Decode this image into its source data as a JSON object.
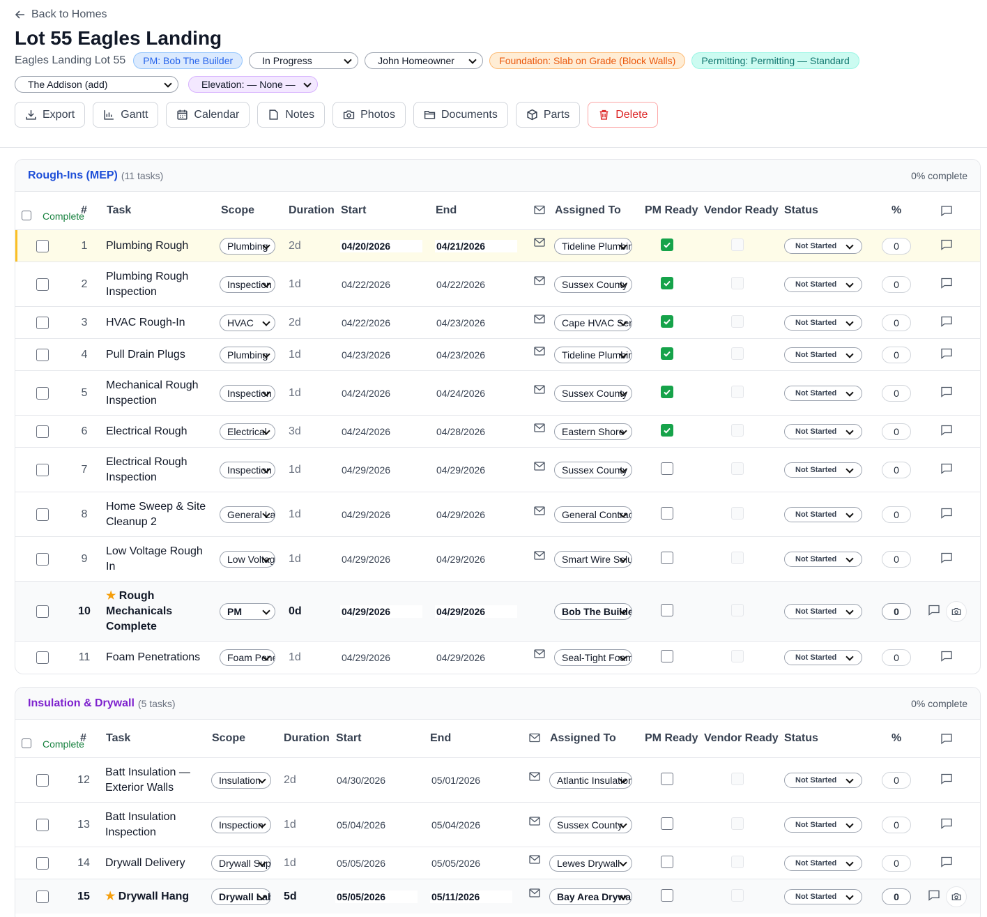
{
  "header": {
    "back_label": "Back to Homes",
    "title": "Lot 55 Eagles Landing",
    "subtitle": "Eagles Landing Lot 55",
    "pm_badge": "PM: Bob The Builder",
    "status_select": "In Progress",
    "homeowner_select": "John Homeowner",
    "foundation_badge": "Foundation: Slab on Grade (Block Walls)",
    "permitting_badge": "Permitting: Permitting — Standard",
    "plan_select": "The Addison (add)",
    "elevation_select": "Elevation: — None —"
  },
  "toolbar": {
    "export": "Export",
    "gantt": "Gantt",
    "calendar": "Calendar",
    "notes": "Notes",
    "photos": "Photos",
    "documents": "Documents",
    "parts": "Parts",
    "delete": "Delete"
  },
  "colors": {
    "section1": "#1d4ed8",
    "section2": "#7e22ce"
  },
  "columns": {
    "complete": "Complete",
    "num": "#",
    "task": "Task",
    "scope": "Scope",
    "duration": "Duration",
    "start": "Start",
    "end": "End",
    "assigned": "Assigned To",
    "pm_ready": "PM Ready",
    "vendor_ready": "Vendor Ready",
    "status": "Status",
    "pct": "%"
  },
  "sections": [
    {
      "name": "Rough-Ins (MEP)",
      "count": "(11 tasks)",
      "complete": "0% complete",
      "rows": [
        {
          "num": "1",
          "task": "Plumbing Rough",
          "scope": "Plumbing",
          "dur": "2d",
          "start": "04/20/2026",
          "end": "04/21/2026",
          "assigned": "Tideline Plumbing",
          "pm": true,
          "status": "Not Started",
          "pct": "0",
          "env": true,
          "type": "hl"
        },
        {
          "num": "2",
          "task": "Plumbing Rough Inspection",
          "scope": "Inspection",
          "dur": "1d",
          "start": "04/22/2026",
          "end": "04/22/2026",
          "assigned": "Sussex County",
          "pm": true,
          "status": "Not Started",
          "pct": "0",
          "env": true
        },
        {
          "num": "3",
          "task": "HVAC Rough-In",
          "scope": "HVAC",
          "dur": "2d",
          "start": "04/22/2026",
          "end": "04/23/2026",
          "assigned": "Cape HVAC Service",
          "pm": true,
          "status": "Not Started",
          "pct": "0",
          "env": true
        },
        {
          "num": "4",
          "task": "Pull Drain Plugs",
          "scope": "Plumbing",
          "dur": "1d",
          "start": "04/23/2026",
          "end": "04/23/2026",
          "assigned": "Tideline Plumbing",
          "pm": true,
          "status": "Not Started",
          "pct": "0",
          "env": true
        },
        {
          "num": "5",
          "task": "Mechanical Rough Inspection",
          "scope": "Inspection",
          "dur": "1d",
          "start": "04/24/2026",
          "end": "04/24/2026",
          "assigned": "Sussex County",
          "pm": true,
          "status": "Not Started",
          "pct": "0",
          "env": true
        },
        {
          "num": "6",
          "task": "Electrical Rough",
          "scope": "Electrical",
          "dur": "3d",
          "start": "04/24/2026",
          "end": "04/28/2026",
          "assigned": "Eastern Shore",
          "pm": true,
          "status": "Not Started",
          "pct": "0",
          "env": true
        },
        {
          "num": "7",
          "task": "Electrical Rough Inspection",
          "scope": "Inspection",
          "dur": "1d",
          "start": "04/29/2026",
          "end": "04/29/2026",
          "assigned": "Sussex County",
          "pm": false,
          "status": "Not Started",
          "pct": "0",
          "env": true
        },
        {
          "num": "8",
          "task": "Home Sweep & Site Cleanup 2",
          "scope": "General Labor",
          "dur": "1d",
          "start": "04/29/2026",
          "end": "04/29/2026",
          "assigned": "General Contractor",
          "pm": false,
          "status": "Not Started",
          "pct": "0",
          "env": true
        },
        {
          "num": "9",
          "task": "Low Voltage Rough In",
          "scope": "Low Voltage",
          "dur": "1d",
          "start": "04/29/2026",
          "end": "04/29/2026",
          "assigned": "Smart Wire Solutions",
          "pm": false,
          "status": "Not Started",
          "pct": "0",
          "env": true
        },
        {
          "num": "10",
          "task": "Rough Mechanicals Complete",
          "scope": "PM",
          "dur": "0d",
          "start": "04/29/2026",
          "end": "04/29/2026",
          "assigned": "Bob The Builder",
          "pm": false,
          "status": "Not Started",
          "pct": "0",
          "env": false,
          "type": "ms",
          "star": "★"
        },
        {
          "num": "11",
          "task": "Foam Penetrations",
          "scope": "Foam Penetrations",
          "dur": "1d",
          "start": "04/29/2026",
          "end": "04/29/2026",
          "assigned": "Seal-Tight Foam",
          "pm": false,
          "status": "Not Started",
          "pct": "0",
          "env": true
        }
      ]
    },
    {
      "name": "Insulation & Drywall",
      "count": "(5 tasks)",
      "complete": "0% complete",
      "rows": [
        {
          "num": "12",
          "task": "Batt Insulation — Exterior Walls",
          "scope": "Insulation",
          "dur": "2d",
          "start": "04/30/2026",
          "end": "05/01/2026",
          "assigned": "Atlantic Insulation",
          "pm": false,
          "status": "Not Started",
          "pct": "0",
          "env": true
        },
        {
          "num": "13",
          "task": "Batt Insulation Inspection",
          "scope": "Inspection",
          "dur": "1d",
          "start": "05/04/2026",
          "end": "05/04/2026",
          "assigned": "Sussex County",
          "pm": false,
          "status": "Not Started",
          "pct": "0",
          "env": true
        },
        {
          "num": "14",
          "task": "Drywall Delivery",
          "scope": "Drywall Supply",
          "dur": "1d",
          "start": "05/05/2026",
          "end": "05/05/2026",
          "assigned": "Lewes Drywall",
          "pm": false,
          "status": "Not Started",
          "pct": "0",
          "env": true
        },
        {
          "num": "15",
          "task": "Drywall Hang",
          "scope": "Drywall Labor",
          "dur": "5d",
          "start": "05/05/2026",
          "end": "05/11/2026",
          "assigned": "Bay Area Drywall",
          "pm": false,
          "status": "Not Started",
          "pct": "0",
          "env": true,
          "type": "ms",
          "star": "★"
        }
      ]
    }
  ]
}
